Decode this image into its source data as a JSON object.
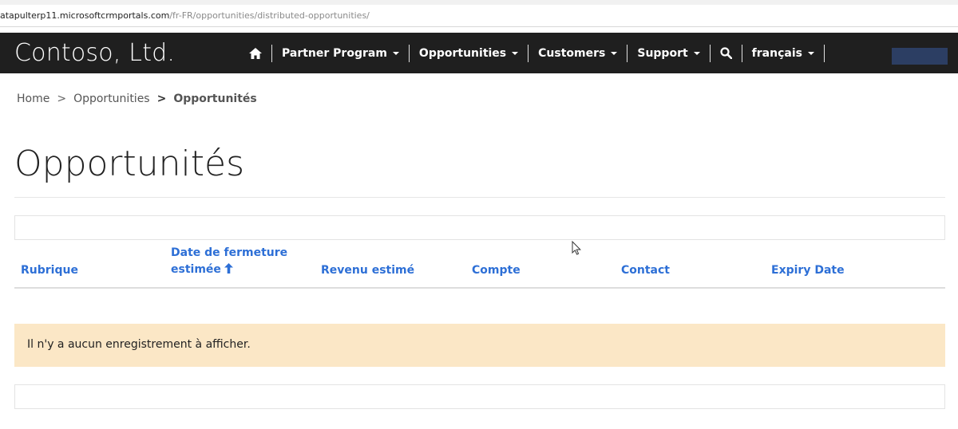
{
  "browser": {
    "url_host": "atapulterp11.microsoftcrmportals.com",
    "url_path": "/fr-FR/opportunities/distributed-opportunities/"
  },
  "navbar": {
    "brand": "Contoso, Ltd.",
    "items": [
      {
        "label": "Partner Program"
      },
      {
        "label": "Opportunities"
      },
      {
        "label": "Customers"
      },
      {
        "label": "Support"
      },
      {
        "label": "français"
      }
    ],
    "user_box_color": "#2c3e63"
  },
  "breadcrumb": {
    "home": "Home",
    "sep1": ">",
    "opportunities": "Opportunities",
    "sep2": ">",
    "current": "Opportunités"
  },
  "page": {
    "title": "Opportunités"
  },
  "table": {
    "columns": [
      {
        "label": "Rubrique"
      },
      {
        "label_line1": "Date de fermeture",
        "label_line2": "estimée",
        "sort": "ascending"
      },
      {
        "label": "Revenu estimé"
      },
      {
        "label": "Compte"
      },
      {
        "label": "Contact"
      },
      {
        "label": "Expiry Date"
      }
    ],
    "empty_message": "Il n'y a aucun enregistrement à afficher."
  },
  "colors": {
    "navbar_bg": "#1f1f1f",
    "link_blue": "#2d6fd6",
    "empty_bg": "#fbe7c6"
  }
}
